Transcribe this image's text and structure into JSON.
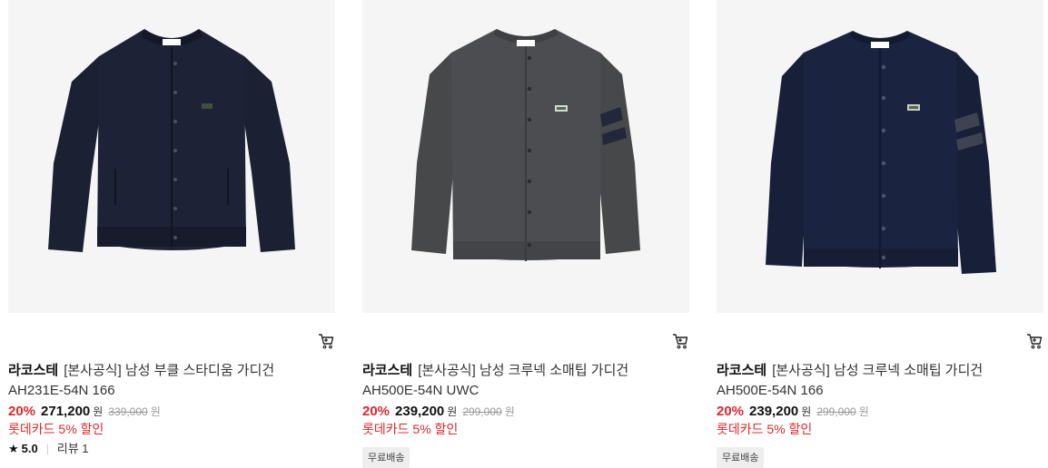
{
  "products": [
    {
      "brand": "라코스테",
      "name": "[본사공식] 남성 부클 스타디움 가디건",
      "code": "AH231E-54N 166",
      "discount": "20%",
      "sale_price": "271,200",
      "currency": "원",
      "original_price": "339,000",
      "card_discount": "롯데카드 5% 할인",
      "rating": "5.0",
      "review_label": "리뷰 1",
      "color": "#1b2033"
    },
    {
      "brand": "라코스테",
      "name": "[본사공식] 남성 크루넥 소매팁 가디건",
      "code": "AH500E-54N UWC",
      "discount": "20%",
      "sale_price": "239,200",
      "currency": "원",
      "original_price": "299,000",
      "card_discount": "롯데카드 5% 할인",
      "badge": "무료배송",
      "color": "#4a4b4d"
    },
    {
      "brand": "라코스테",
      "name": "[본사공식] 남성 크루넥 소매팁 가디건",
      "code": "AH500E-54N 166",
      "discount": "20%",
      "sale_price": "239,200",
      "currency": "원",
      "original_price": "299,000",
      "card_discount": "롯데카드 5% 할인",
      "badge": "무료배송",
      "color": "#1a2340"
    }
  ],
  "icons": {
    "cart": "cart-icon",
    "star": "star-icon"
  },
  "colors": {
    "discount": "#e0262b",
    "badge_bg": "#eeeeee"
  }
}
